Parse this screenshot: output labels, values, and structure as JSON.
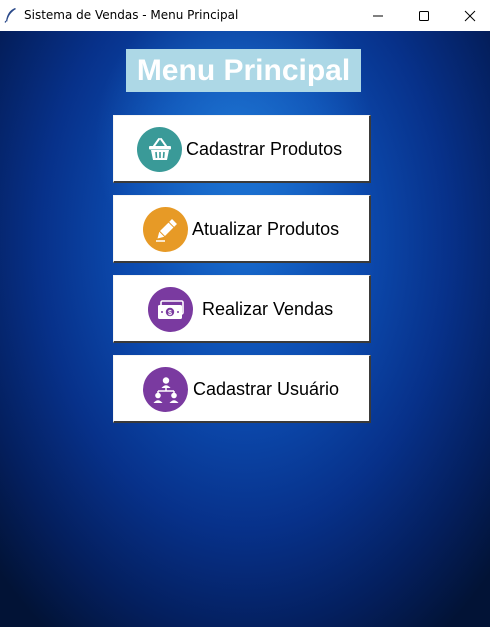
{
  "window": {
    "title": "Sistema de Vendas - Menu Principal",
    "app_icon": "feather-icon",
    "controls": [
      "minimize-icon",
      "maximize-icon",
      "close-icon"
    ]
  },
  "main": {
    "title": "Menu Principal",
    "title_background": "#add8e6",
    "buttons": [
      {
        "label": "Cadastrar Produtos",
        "icon": "basket-icon",
        "icon_color": "#3a9a98"
      },
      {
        "label": "Atualizar Produtos",
        "icon": "pencil-icon",
        "icon_color": "#e79a26"
      },
      {
        "label": "Realizar Vendas",
        "icon": "money-icon",
        "icon_color": "#7a3aa0"
      },
      {
        "label": "Cadastrar Usuário",
        "icon": "users-network-icon",
        "icon_color": "#7a3aa0"
      }
    ]
  }
}
